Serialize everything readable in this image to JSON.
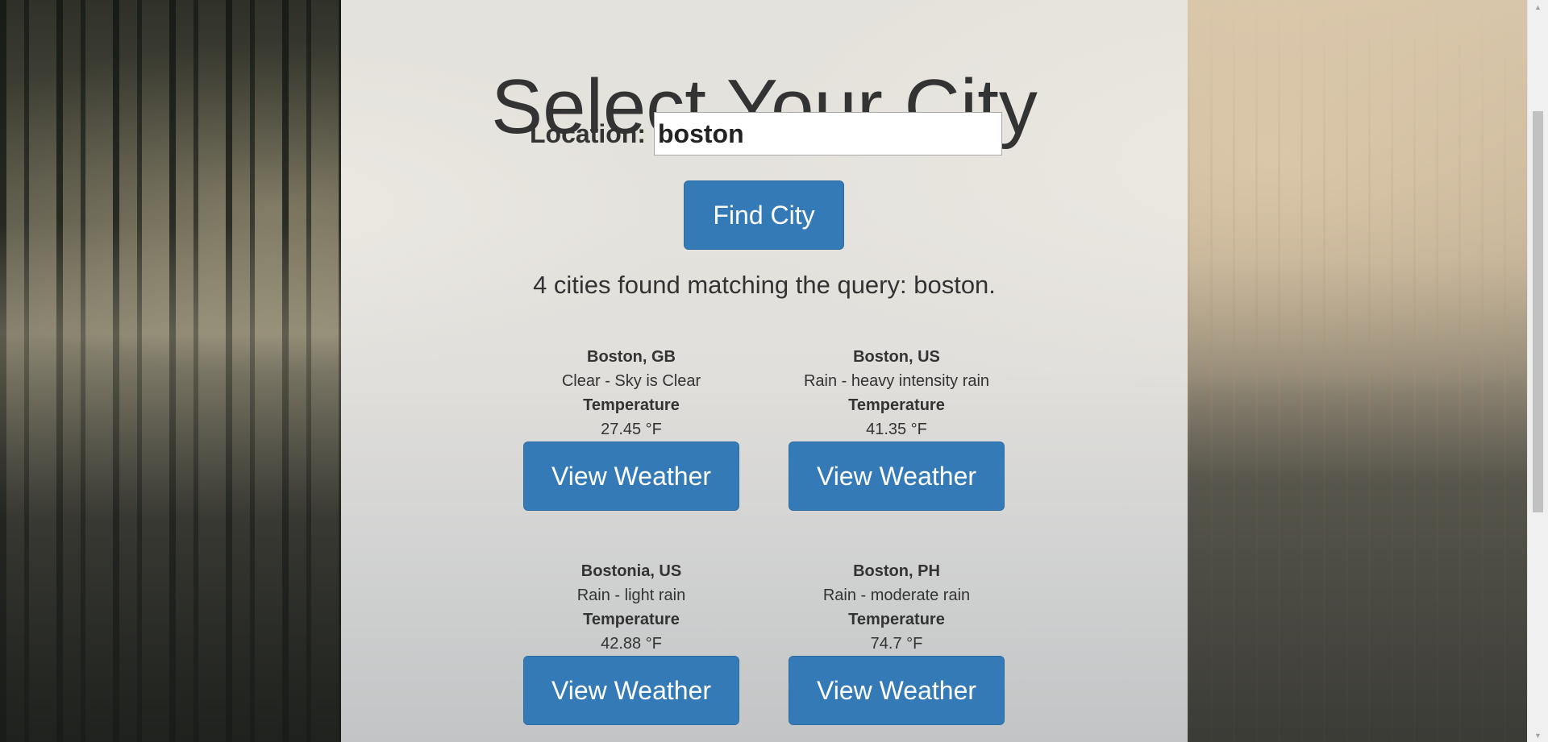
{
  "page": {
    "title": "Select Your City"
  },
  "search": {
    "label": "Location:",
    "value": "boston"
  },
  "find_button": {
    "label": "Find City"
  },
  "result_summary": "4 cities found matching the query: boston.",
  "cities": [
    {
      "name": "Boston, GB",
      "description": "Clear - Sky is Clear",
      "temp_label": "Temperature",
      "temp": "27.45 °F",
      "button_label": "View Weather"
    },
    {
      "name": "Boston, US",
      "description": "Rain - heavy intensity rain",
      "temp_label": "Temperature",
      "temp": "41.35 °F",
      "button_label": "View Weather"
    },
    {
      "name": "Bostonia, US",
      "description": "Rain - light rain",
      "temp_label": "Temperature",
      "temp": "42.88 °F",
      "button_label": "View Weather"
    },
    {
      "name": "Boston, PH",
      "description": "Rain - moderate rain",
      "temp_label": "Temperature",
      "temp": "74.7 °F",
      "button_label": "View Weather"
    }
  ],
  "colors": {
    "primary_button": "#337ab7",
    "text": "#333333"
  },
  "icons": {
    "scroll_up": "triangle-up-icon",
    "scroll_down": "triangle-down-icon"
  }
}
